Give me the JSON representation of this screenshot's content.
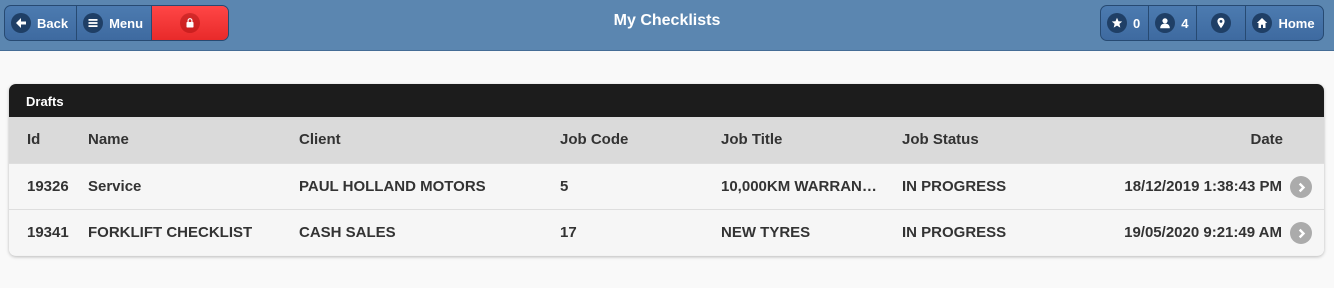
{
  "header": {
    "title": "My Checklists",
    "back_label": "Back",
    "menu_label": "Menu",
    "favorites_count": "0",
    "users_count": "4",
    "home_label": "Home"
  },
  "colors": {
    "header_bg": "#5b86b0",
    "button_bg": "#3e6aa0",
    "lock_button": "#ff3b3b",
    "panel_header": "#1c1c1c",
    "table_header": "#dadada"
  },
  "icons": [
    "back-arrow-icon",
    "menu-icon",
    "lock-icon",
    "star-icon",
    "user-icon",
    "location-pin-icon",
    "home-icon",
    "chevron-right-icon"
  ],
  "drafts": {
    "title": "Drafts",
    "columns": {
      "id": "Id",
      "name": "Name",
      "client": "Client",
      "job_code": "Job Code",
      "job_title": "Job Title",
      "job_status": "Job Status",
      "date": "Date"
    },
    "rows": [
      {
        "id": "19326",
        "name": "Service",
        "client": "PAUL HOLLAND MOTORS",
        "job_code": "5",
        "job_title": "10,000KM WARRAN…",
        "job_status": "IN PROGRESS",
        "date": "18/12/2019 1:38:43 PM"
      },
      {
        "id": "19341",
        "name": "FORKLIFT CHECKLIST",
        "client": "CASH SALES",
        "job_code": "17",
        "job_title": "NEW TYRES",
        "job_status": "IN PROGRESS",
        "date": "19/05/2020 9:21:49 AM"
      }
    ]
  }
}
